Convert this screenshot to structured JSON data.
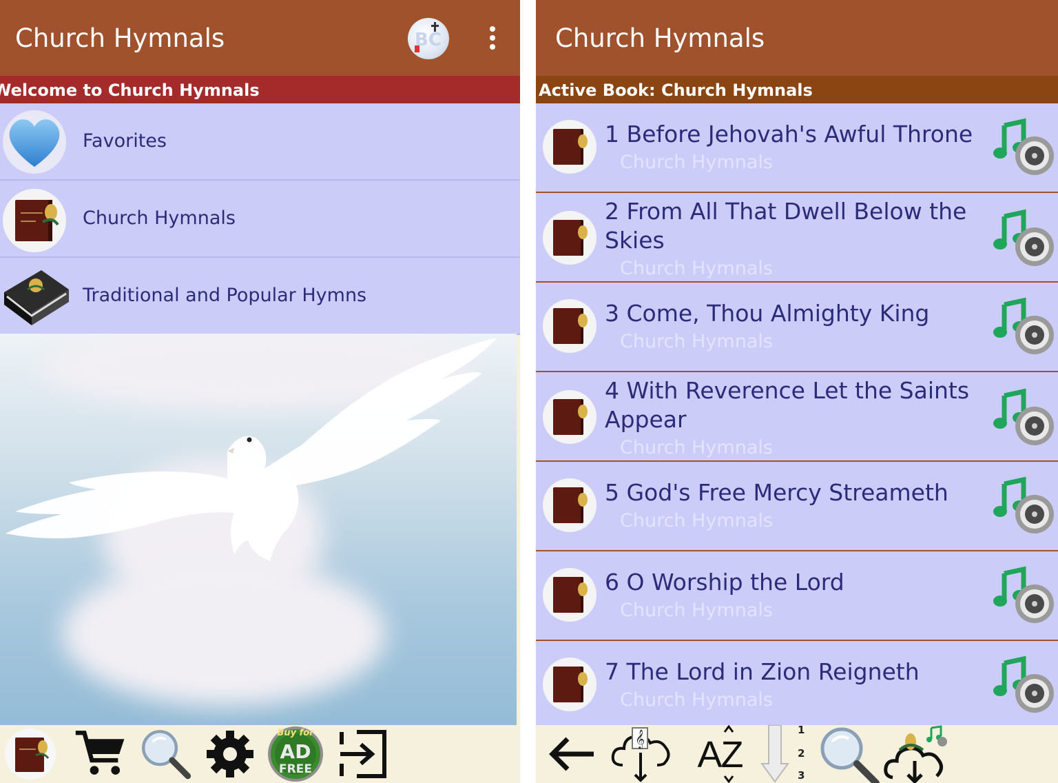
{
  "left": {
    "appbar": {
      "title": "Church Hymnals"
    },
    "banner": "Welcome to Church Hymnals",
    "menu": [
      {
        "label": "Favorites",
        "icon": "heart-icon"
      },
      {
        "label": "Church Hymnals",
        "icon": "hymnal-book-icon"
      },
      {
        "label": "Traditional and Popular Hymns",
        "icon": "black-book-icon"
      }
    ],
    "ad_badge": {
      "top": "Buy for",
      "main": "AD",
      "bottom": "FREE"
    }
  },
  "right": {
    "appbar": {
      "title": "Church Hymnals"
    },
    "banner": "Active Book: Church Hymnals",
    "hymns": [
      {
        "title": "1 Before Jehovah's Awful Throne",
        "book": "Church Hymnals"
      },
      {
        "title": "2 From All That Dwell Below the Skies",
        "book": "Church Hymnals"
      },
      {
        "title": "3 Come, Thou Almighty King",
        "book": "Church Hymnals"
      },
      {
        "title": "4 With Reverence Let the Saints Appear",
        "book": "Church Hymnals"
      },
      {
        "title": "5 God's Free Mercy Streameth",
        "book": "Church Hymnals"
      },
      {
        "title": "6 O Worship the Lord",
        "book": "Church Hymnals"
      },
      {
        "title": "7 The Lord in Zion Reigneth",
        "book": "Church Hymnals"
      }
    ],
    "sort_label": "AZ",
    "number_sort": [
      "1",
      "2",
      "3"
    ]
  },
  "colors": {
    "appbar": "#a0522d",
    "banner_left": "#a52a2a",
    "banner_right": "#8b4513",
    "list_bg": "#ccccf8",
    "item_text": "#2b2b7a"
  }
}
